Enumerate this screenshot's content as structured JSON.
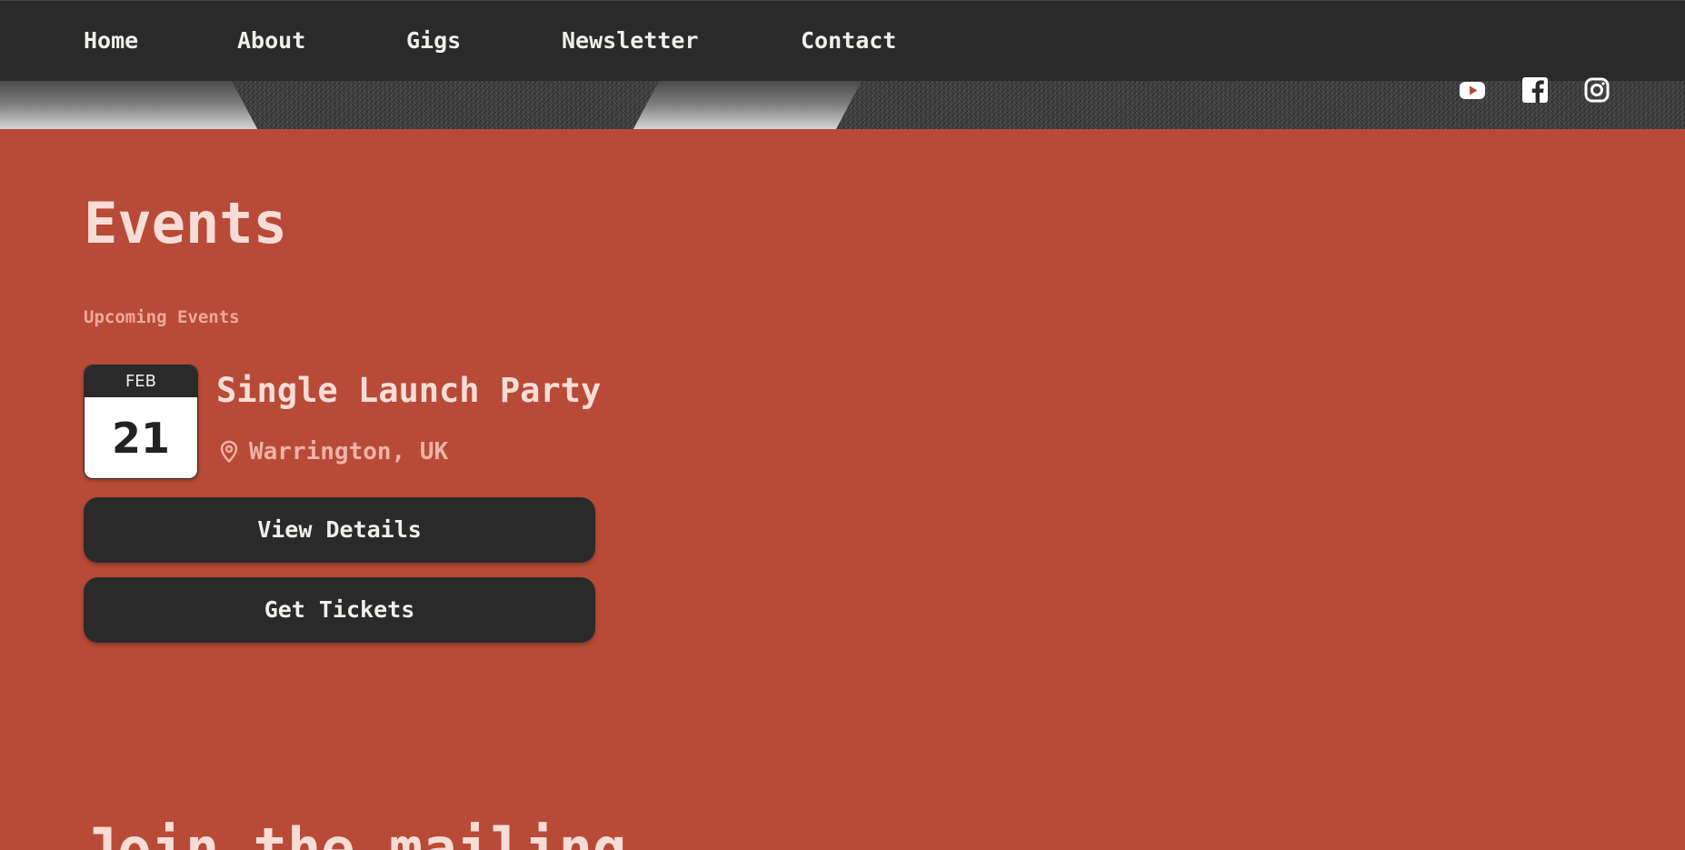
{
  "nav": {
    "items": [
      {
        "label": "Home"
      },
      {
        "label": "About"
      },
      {
        "label": "Gigs"
      },
      {
        "label": "Newsletter"
      },
      {
        "label": "Contact"
      }
    ]
  },
  "social": {
    "icons": [
      "youtube-icon",
      "facebook-icon",
      "instagram-icon"
    ]
  },
  "events": {
    "title": "Events",
    "section_label": "Upcoming Events",
    "items": [
      {
        "month": "FEB",
        "day": "21",
        "title": "Single Launch Party",
        "location": "Warrington, UK",
        "details_label": "View Details",
        "tickets_label": "Get Tickets"
      }
    ]
  },
  "mailing": {
    "heading": "Join the mailing"
  },
  "colors": {
    "background": "#b84b37",
    "nav_background": "#2a2a2a",
    "button_background": "#2a2a2a",
    "heading_text": "#f8ddd7",
    "muted_text": "#efa89b"
  }
}
